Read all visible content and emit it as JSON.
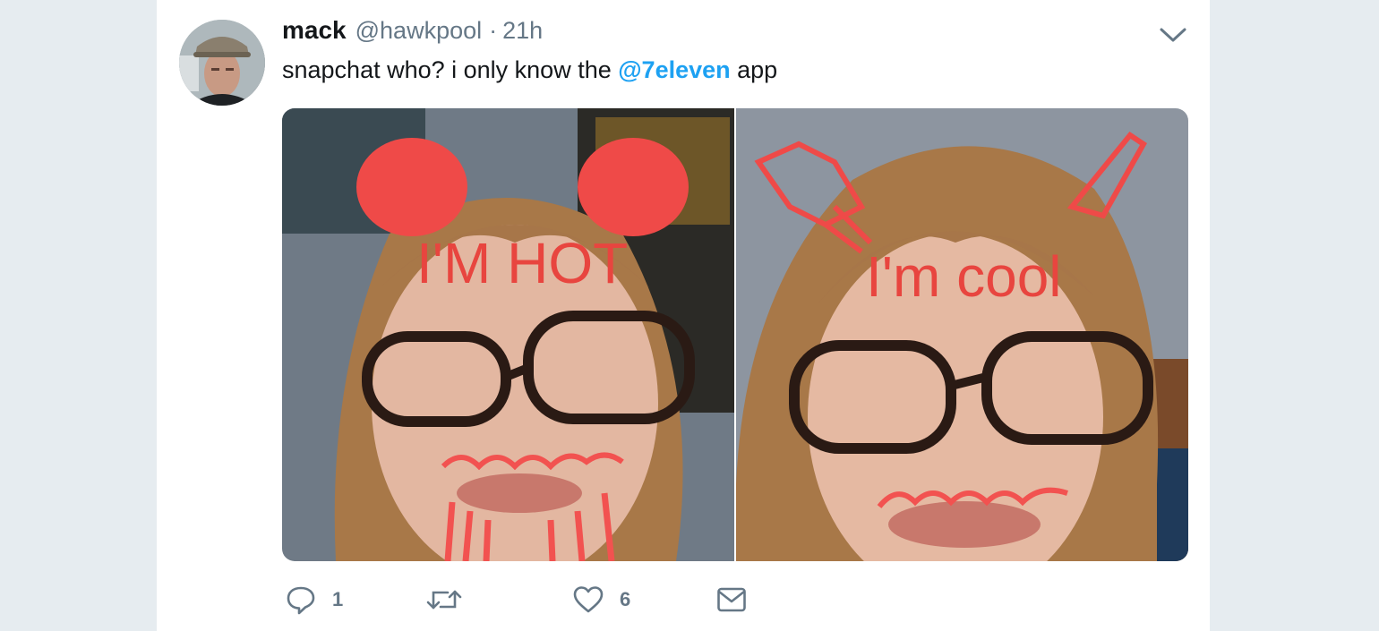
{
  "tweet": {
    "author_name": "mack",
    "author_handle": "@hawkpool",
    "separator": "·",
    "timestamp": "21h",
    "text_before": "snapchat who? i only know the ",
    "mention": "@7eleven",
    "text_after": " app",
    "accent_color": "#1da1f2"
  },
  "media": {
    "left_photo_caption": "I'M HOT",
    "right_photo_caption": "I'm cool"
  },
  "actions": {
    "reply_count": "1",
    "retweet_count": "",
    "like_count": "6",
    "icons": [
      "reply-icon",
      "retweet-icon",
      "like-icon",
      "message-icon"
    ]
  }
}
